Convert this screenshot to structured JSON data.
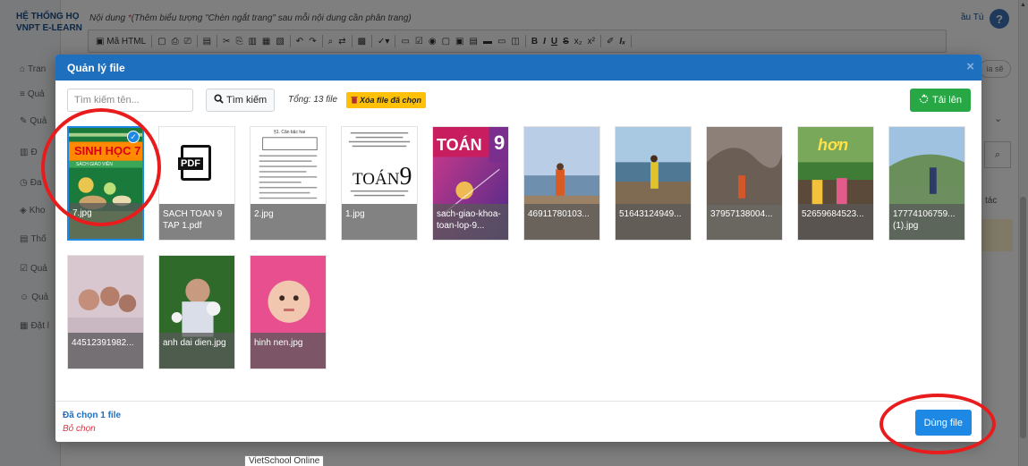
{
  "background": {
    "brand_line1": "HỆ THỐNG HỌ",
    "brand_line2": "VNPT E-LEARN",
    "nav": [
      "Tran",
      "Quả",
      "Quả",
      "Đ",
      "Đa",
      "Kho",
      "Thố",
      "Quả",
      "Quả",
      "Đặt l"
    ],
    "editor_label": "Nội dung ",
    "editor_required": "*",
    "editor_hint": "(Thêm biểu tượng \"Chèn ngắt trang\" sau mỗi nội dung cần phân trang)",
    "toolbar_source": "Mã HTML",
    "toolbar_bold": "B",
    "toolbar_italic": "I",
    "toolbar_underline": "U",
    "toolbar_strike": "S",
    "toolbar_sub": "x₂",
    "toolbar_sup": "x²",
    "toolbar_clear": "Iₓ",
    "user_text": "ầu Tú",
    "help_label": "?",
    "right_pill": "ia sẽ",
    "right_tac": "tác",
    "bottom_label": "VietSchool Online"
  },
  "modal": {
    "title": "Quản lý file",
    "close_label": "×",
    "search_placeholder": "Tìm kiếm tên...",
    "search_button": "Tìm kiếm",
    "total_text": "Tổng: 13 file",
    "delete_selected": "Xóa file đã chọn",
    "upload_button": "Tải lên",
    "chosen_text": "Đã chọn 1 file",
    "deselect_text": "Bỏ chọn",
    "use_button": "Dùng file"
  },
  "files": [
    {
      "name": "7.jpg",
      "selected": true,
      "cover_title": "SINH HỌC 7",
      "cover_sub": "SÁCH GIÁO VIÊN",
      "cover_num": "7"
    },
    {
      "name": "SACH TOAN 9 TAP 1.pdf",
      "selected": false,
      "pdf_label": "PDF"
    },
    {
      "name": "2.jpg",
      "selected": false,
      "doc_title": "§1. Căn bậc hai"
    },
    {
      "name": "1.jpg",
      "selected": false,
      "doc_title": "TOÁN",
      "doc_num": "9"
    },
    {
      "name": "sach-giao-khoa-toan-lop-9...",
      "selected": false,
      "cover_title": "TOÁN",
      "cover_num": "9"
    },
    {
      "name": "46911780103...",
      "selected": false
    },
    {
      "name": "51643124949...",
      "selected": false
    },
    {
      "name": "37957138004...",
      "selected": false
    },
    {
      "name": "52659684523...",
      "selected": false,
      "overlay_text": "hơn"
    },
    {
      "name": "17774106759... (1).jpg",
      "selected": false
    },
    {
      "name": "44512391982...",
      "selected": false
    },
    {
      "name": "anh dai dien.jpg",
      "selected": false
    },
    {
      "name": "hinh nen.jpg",
      "selected": false
    }
  ],
  "colors": {
    "header_blue": "#1f6fbf",
    "select_blue": "#1e88e5",
    "upload_green": "#28a745",
    "delete_yellow": "#ffc107",
    "annotation_red": "#e81c1c"
  }
}
